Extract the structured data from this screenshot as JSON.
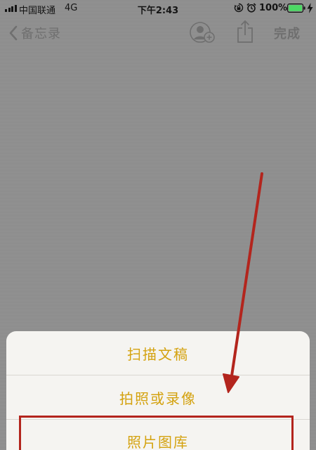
{
  "status_bar": {
    "carrier": "中国联通",
    "network": "4G",
    "time": "下午2:43",
    "battery_percent": "100%"
  },
  "nav": {
    "back_label": "备忘录",
    "done_label": "完成"
  },
  "action_sheet": {
    "items": [
      {
        "label": "扫描文稿"
      },
      {
        "label": "拍照或录像"
      },
      {
        "label": "照片图库"
      }
    ],
    "text_color": "#d4a20f"
  },
  "annotation": {
    "color": "#b3251d",
    "highlighted_item": "照片图库"
  },
  "icons": {
    "status": [
      "signal-icon",
      "rotation-lock-icon",
      "alarm-icon",
      "battery-icon",
      "charging-icon"
    ],
    "nav": [
      "back-chevron-icon",
      "share-person-icon",
      "share-icon"
    ]
  }
}
